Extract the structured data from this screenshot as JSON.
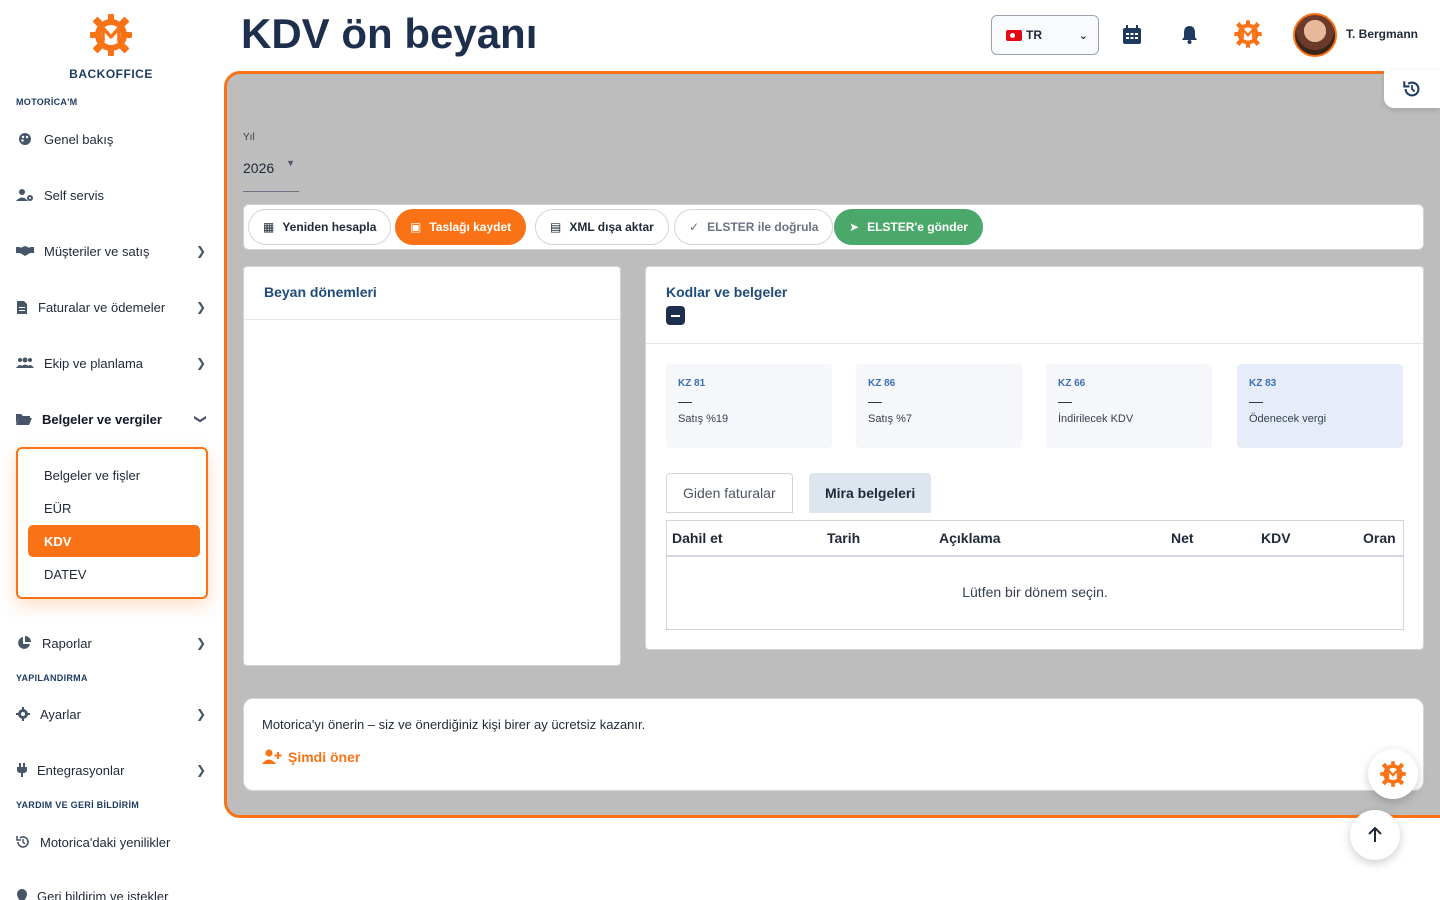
{
  "brand": {
    "name": "BACKOFFICE"
  },
  "sidebar": {
    "sections": [
      {
        "label": "MOTORİCA'M"
      },
      {
        "label": "YAPILANDIRMA"
      },
      {
        "label": "YARDIM VE GERİ BİLDİRİM"
      }
    ],
    "items": [
      {
        "label": "Genel bakış",
        "icon": "palette-icon"
      },
      {
        "label": "Self servis",
        "icon": "user-gear-icon"
      },
      {
        "label": "Müşteriler ve satış",
        "icon": "handshake-icon"
      },
      {
        "label": "Faturalar ve ödemeler",
        "icon": "invoice-icon"
      },
      {
        "label": "Ekip ve planlama",
        "icon": "users-icon"
      },
      {
        "label": "Belgeler ve vergiler",
        "icon": "folder-open-icon"
      },
      {
        "label": "Raporlar",
        "icon": "pie-chart-icon"
      },
      {
        "label": "Ayarlar",
        "icon": "gear-icon"
      },
      {
        "label": "Entegrasyonlar",
        "icon": "plug-icon"
      },
      {
        "label": "Motorica'daki yenilikler",
        "icon": "history-icon"
      },
      {
        "label": "Geri bildirim ve istekler",
        "icon": "location-icon"
      }
    ],
    "submenu": [
      {
        "label": "Belgeler ve fişler"
      },
      {
        "label": "EÜR"
      },
      {
        "label": "KDV"
      },
      {
        "label": "DATEV"
      }
    ]
  },
  "header": {
    "title": "KDV ön beyanı",
    "language": "TR",
    "user_name": "T. Bergmann"
  },
  "filters": {
    "year_label": "Yıl",
    "year_value": "2026"
  },
  "toolbar": {
    "recalc": "Yeniden hesapla",
    "save_draft": "Taslağı kaydet",
    "export_xml": "XML dışa aktar",
    "validate": "ELSTER ile doğrula",
    "send": "ELSTER'e gönder"
  },
  "periods_card": {
    "title": "Beyan dönemleri"
  },
  "codes_card": {
    "title": "Kodlar ve belgeler",
    "kz": [
      {
        "code": "KZ 81",
        "value": "—",
        "label": "Satış %19"
      },
      {
        "code": "KZ 86",
        "value": "—",
        "label": "Satış %7"
      },
      {
        "code": "KZ 66",
        "value": "—",
        "label": "İndirilecek KDV"
      },
      {
        "code": "KZ 83",
        "value": "—",
        "label": "Ödenecek vergi"
      }
    ],
    "tabs": [
      {
        "label": "Giden faturalar"
      },
      {
        "label": "Mira belgeleri"
      }
    ],
    "columns": [
      "Dahil et",
      "Tarih",
      "Açıklama",
      "Net",
      "KDV",
      "Oran"
    ],
    "empty_message": "Lütfen bir dönem seçin."
  },
  "referral": {
    "text": "Motorica'yı önerin – siz ve önerdiğiniz kişi birer ay ücretsiz kazanır.",
    "link": "Şimdi öner"
  },
  "colors": {
    "accent": "#f97316",
    "navy": "#1e2f4d",
    "green": "#4aa86a"
  }
}
